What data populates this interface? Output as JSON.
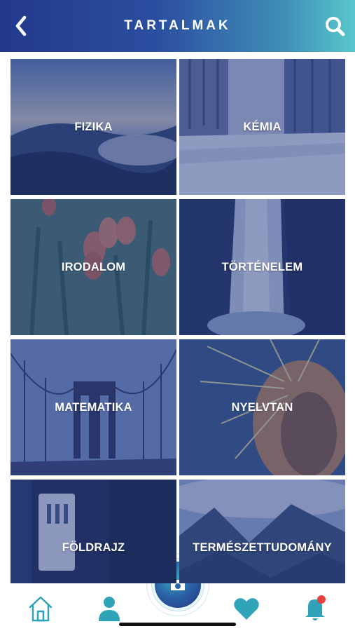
{
  "header": {
    "title": "TARTALMAK",
    "back_icon": "chevron-left-icon",
    "search_icon": "search-icon"
  },
  "tiles": [
    {
      "label": "FIZIKA",
      "scene": "mountain-sunset"
    },
    {
      "label": "KÉMIA",
      "scene": "snowy-forest-road"
    },
    {
      "label": "IRODALOM",
      "scene": "tulips"
    },
    {
      "label": "TÖRTÉNELEM",
      "scene": "waterfall"
    },
    {
      "label": "MATEMATIKA",
      "scene": "suspension-bridge"
    },
    {
      "label": "NYELVTAN",
      "scene": "cactus-closeup"
    },
    {
      "label": "FÖLDRAJZ",
      "scene": "sign-post"
    },
    {
      "label": "TERMÉSZETTUDOMÁNY",
      "scene": "misty-mountains"
    }
  ],
  "tabbar": {
    "items": [
      {
        "icon": "home-icon"
      },
      {
        "icon": "user-icon"
      },
      {
        "icon": "camera-icon"
      },
      {
        "icon": "heart-icon"
      },
      {
        "icon": "bell-icon",
        "badge": true
      }
    ]
  },
  "colors": {
    "header_start": "#23388c",
    "header_end": "#58c7cc",
    "accent": "#2fa3b8",
    "tile_tint": "#263a82",
    "badge": "#e8413c"
  }
}
